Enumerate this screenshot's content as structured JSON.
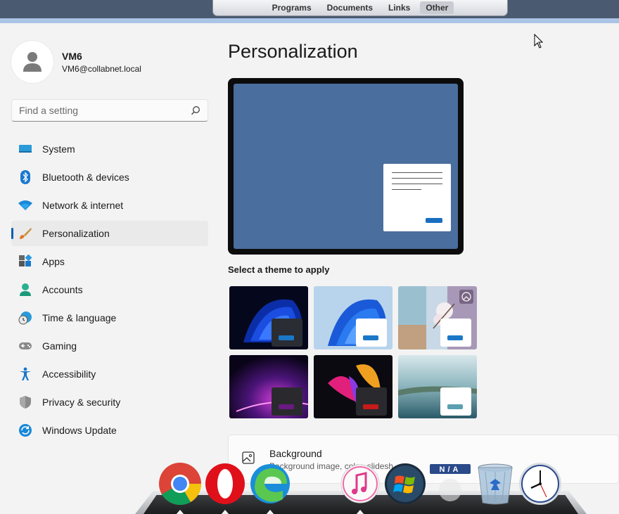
{
  "launcher": {
    "tabs": [
      {
        "label": "Programs"
      },
      {
        "label": "Documents"
      },
      {
        "label": "Links"
      },
      {
        "label": "Other"
      }
    ],
    "active": "Other"
  },
  "profile": {
    "name": "VM6",
    "email": "VM6@collabnet.local"
  },
  "search": {
    "placeholder": "Find a setting",
    "value": ""
  },
  "nav": {
    "items": [
      {
        "label": "System",
        "icon": "system-icon"
      },
      {
        "label": "Bluetooth & devices",
        "icon": "bluetooth-icon"
      },
      {
        "label": "Network & internet",
        "icon": "wifi-icon"
      },
      {
        "label": "Personalization",
        "icon": "brush-icon",
        "selected": true
      },
      {
        "label": "Apps",
        "icon": "apps-icon"
      },
      {
        "label": "Accounts",
        "icon": "accounts-icon"
      },
      {
        "label": "Time & language",
        "icon": "clock-globe-icon"
      },
      {
        "label": "Gaming",
        "icon": "gamepad-icon"
      },
      {
        "label": "Accessibility",
        "icon": "accessibility-icon"
      },
      {
        "label": "Privacy & security",
        "icon": "shield-icon"
      },
      {
        "label": "Windows Update",
        "icon": "update-icon"
      }
    ]
  },
  "main": {
    "title": "Personalization",
    "theme_label": "Select a theme to apply",
    "themes": [
      {
        "name": "windows-dark",
        "chip_color": "#2a2d33",
        "bar_color": "#1a78c8"
      },
      {
        "name": "windows-light",
        "chip_color": "#ffffff",
        "bar_color": "#1a78c8"
      },
      {
        "name": "windows-spotlight",
        "chip_color": "#ffffff",
        "bar_color": "#1a78c8"
      },
      {
        "name": "glow",
        "chip_color": "#2a2a2e",
        "bar_color": "#6a1a80"
      },
      {
        "name": "captured-motion",
        "chip_color": "#2a2a2e",
        "bar_color": "#c81a1a"
      },
      {
        "name": "flow",
        "chip_color": "#ffffff",
        "bar_color": "#5aa0b0"
      }
    ],
    "background": {
      "title": "Background",
      "subtitle": "Background image, color, slidesh"
    }
  },
  "dock": {
    "items": [
      {
        "name": "chrome-icon"
      },
      {
        "name": "opera-icon"
      },
      {
        "name": "edge-icon"
      },
      {
        "name": "itunes-icon"
      },
      {
        "name": "windows-icon"
      },
      {
        "name": "na-icon",
        "label": "N/A"
      },
      {
        "name": "recycle-bin-icon"
      },
      {
        "name": "clock-icon"
      }
    ]
  },
  "colors": {
    "accent": "#005fb8",
    "preview_bg": "#4a6e9e"
  }
}
